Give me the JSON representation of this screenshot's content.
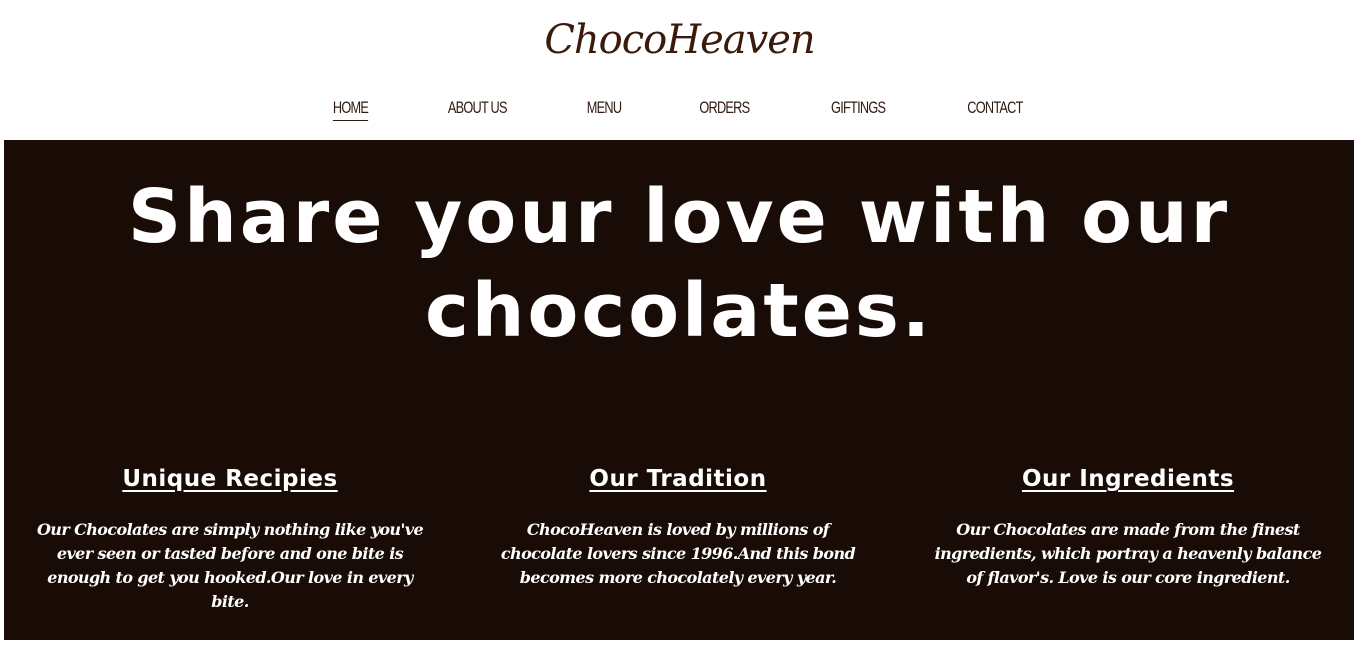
{
  "header": {
    "brand": "ChocoHeaven",
    "nav": [
      {
        "label": "HOME",
        "active": true
      },
      {
        "label": "ABOUT US",
        "active": false
      },
      {
        "label": "MENU",
        "active": false
      },
      {
        "label": "ORDERS",
        "active": false
      },
      {
        "label": "GIFTINGS",
        "active": false
      },
      {
        "label": "CONTACT",
        "active": false
      }
    ]
  },
  "hero": {
    "title_line1": "Share your love with our",
    "title_line2": "chocolates.",
    "features": [
      {
        "heading": "Unique Recipies",
        "text": "Our Chocolates are simply nothing like you've ever seen or tasted before and one bite is enough to get you hooked.Our love in every bite."
      },
      {
        "heading": "Our Tradition",
        "text": "ChocoHeaven is loved by millions of chocolate lovers since 1996.And this bond becomes more chocolately every year."
      },
      {
        "heading": "Our Ingredients",
        "text": "Our Chocolates are made from the finest ingredients, which portray a heavenly balance of flavor's. Love is our core ingredient."
      }
    ]
  },
  "colors": {
    "background": "#ffffff",
    "hero_background": "#190c06",
    "brand_text": "#3a1a0c",
    "nav_text": "#2f1a10",
    "hero_text": "#ffffff"
  }
}
